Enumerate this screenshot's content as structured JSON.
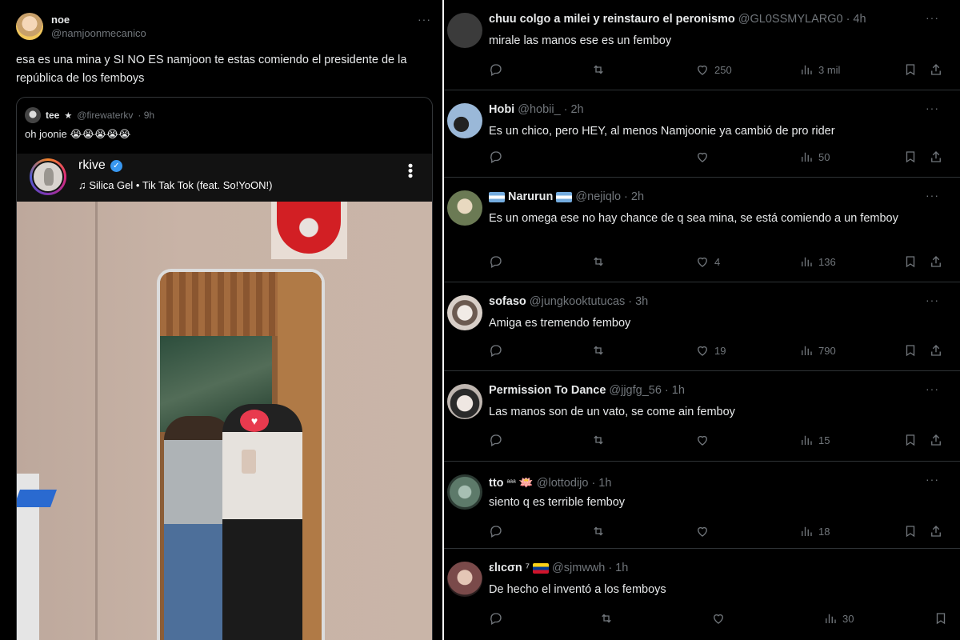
{
  "main_tweet": {
    "name": "noe",
    "handle": "@namjoonmecanico",
    "text": "esa es una mina y SI NO ES namjoon te estas comiendo el presidente de la república de los femboys",
    "quoted": {
      "name": "tee",
      "badge": "★",
      "handle": "@firewaterkv",
      "time": "· 9h",
      "text": "oh joonie 😭😭😭😭😭",
      "instagram": {
        "username": "rkive",
        "song": "Silica Gel • Tik Tak Tok (feat. So!YoON!)"
      },
      "sticker": "♥"
    }
  },
  "replies": [
    {
      "name": "chuu colgo a milei y reinstauro el peronismo",
      "handle": "@GL0SSMYLARG0",
      "time": "· 4h",
      "text": "mirale las manos ese es un femboy",
      "likes": "250",
      "views": "3 mil",
      "avatar_color": "#3b3b3b"
    },
    {
      "name": "Hobi",
      "handle": "@hobii_",
      "time": "· 2h",
      "text": "Es un chico, pero HEY, al menos Namjoonie ya cambió de pro rider",
      "likes": "",
      "views": "50",
      "avatar_color": "#9ab8d8"
    },
    {
      "name": "Narurun",
      "handle": "@nejiqlo",
      "time": "· 2h",
      "text": "Es un omega ese no hay chance de q sea mina, se está comiendo a un femboy",
      "likes": "4",
      "views": "136",
      "avatar_color": "#6b7a54"
    },
    {
      "name": "sofaso",
      "handle": "@jungkooktutucas",
      "time": "· 3h",
      "text": "Amiga es tremendo femboy",
      "likes": "19",
      "views": "790",
      "avatar_color": "#d8cfc8"
    },
    {
      "name": "Permission To Dance",
      "handle": "@jjgfg_56",
      "time": "· 1h",
      "text": "Las manos son de un vato, se come ain femboy",
      "likes": "",
      "views": "15",
      "avatar_color": "#bfb6b0"
    },
    {
      "name": "tto",
      "handle": "@lottodijo",
      "time": "· 1h",
      "text": "siento q es terrible femboy",
      "likes": "",
      "views": "18",
      "avatar_color": "#5d7a6a",
      "decor": "ᵃᵃᵃ",
      "emoji": "🪷"
    },
    {
      "name": "εlιcσn",
      "handle": "@sjmwwh",
      "time": "· 1h",
      "text": "De hecho el inventó a los femboys",
      "likes": "",
      "views": "30",
      "avatar_color": "#7a4a4a",
      "decor": "⁷"
    }
  ],
  "icons": [
    "reply-icon",
    "retweet-icon",
    "like-icon",
    "views-icon",
    "bookmark-icon",
    "share-icon",
    "more-icon",
    "verified-icon",
    "music-note-icon"
  ]
}
